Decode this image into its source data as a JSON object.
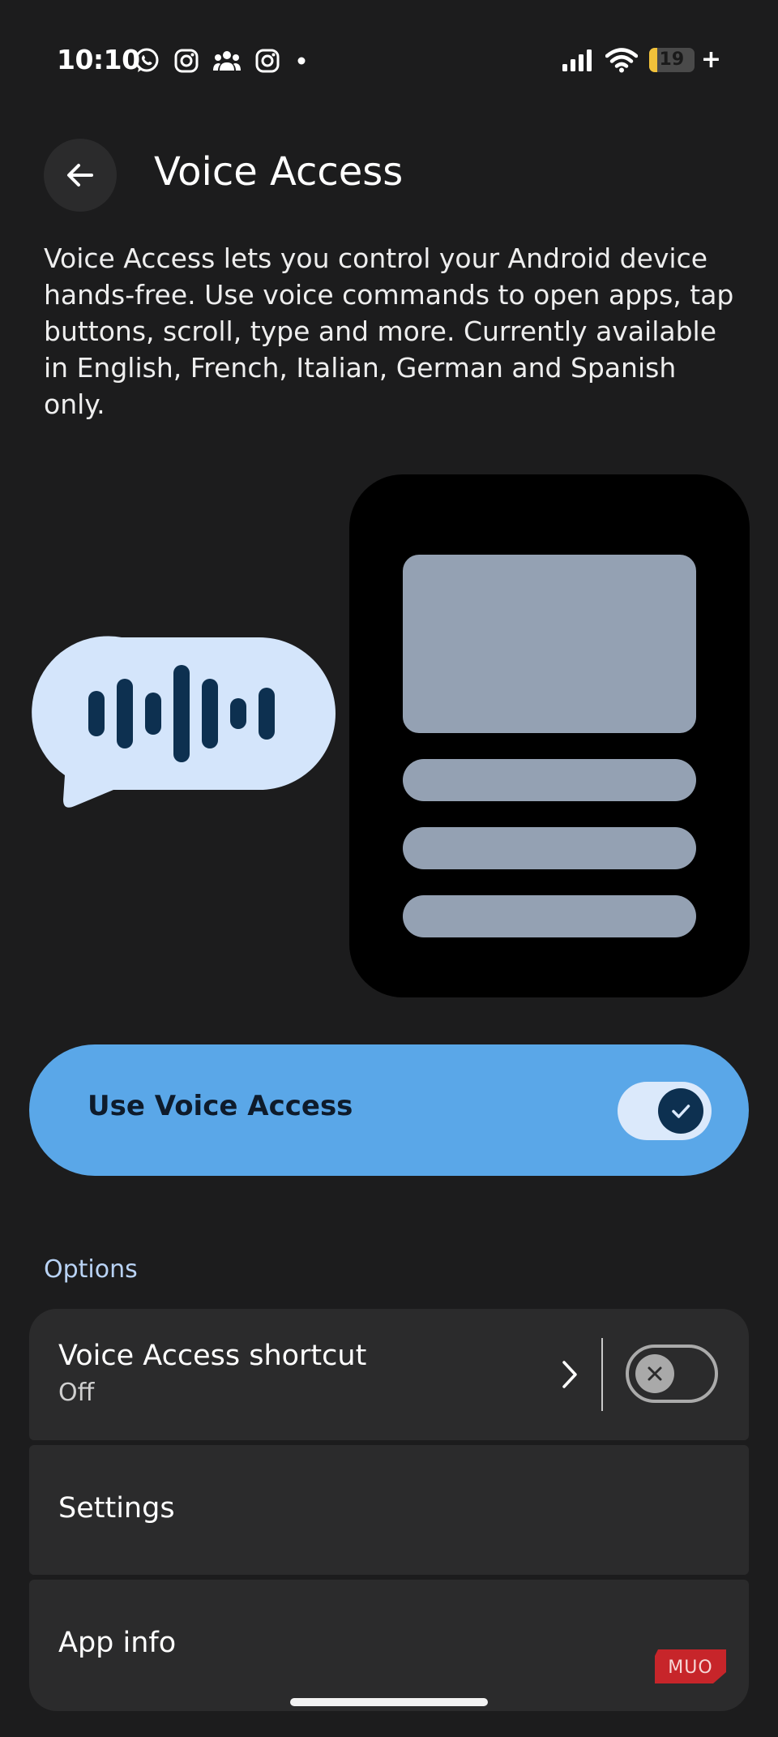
{
  "status_bar": {
    "time": "10:10",
    "notification_icons": [
      "whatsapp-icon",
      "instagram-icon",
      "group-icon",
      "instagram-icon",
      "dot-icon"
    ],
    "battery_level": "19",
    "battery_fraction": 0.19,
    "charging_symbol": "+"
  },
  "header": {
    "title": "Voice Access",
    "back_icon": "arrow-back-icon"
  },
  "description": "Voice Access lets you control your Android device hands-free. Use voice commands to open apps, tap buttons, scroll, type and more. Currently available in English, French, Italian, German and Spanish only.",
  "main_toggle": {
    "label": "Use Voice Access",
    "state": "on"
  },
  "options": {
    "section_title": "Options",
    "items": [
      {
        "title": "Voice Access shortcut",
        "subtitle": "Off",
        "switch_state": "off"
      },
      {
        "title": "Settings"
      },
      {
        "title": "App info"
      }
    ]
  },
  "watermark": "MUO",
  "colors": {
    "background": "#1c1c1d",
    "card": "#2b2b2c",
    "accent": "#5aa7e8",
    "switch_on_track": "#dbe9fb",
    "switch_on_knob": "#0d3050",
    "section_title": "#b9d3f5",
    "bubble": "#d4e5fb",
    "wave": "#0d3050",
    "phone_screen": "#000000",
    "phone_blocks": "#94a1b3",
    "battery": "#f2c23a",
    "watermark": "#c7252a"
  }
}
